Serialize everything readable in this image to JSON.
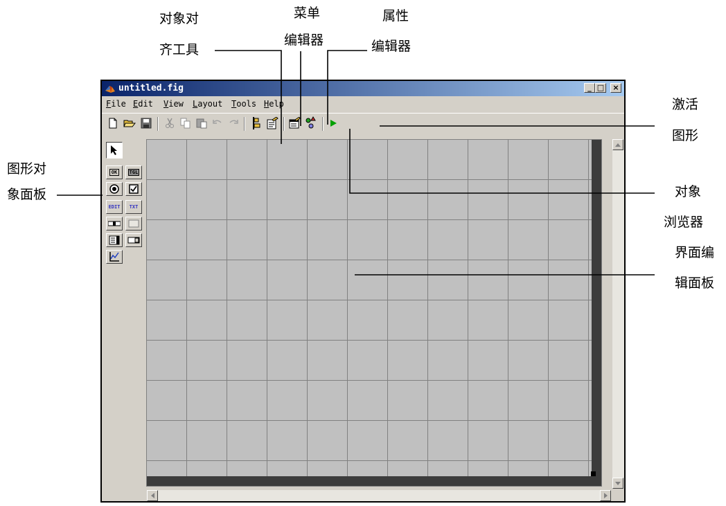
{
  "annotations": {
    "align_line1": "对象对",
    "align_line2": "齐工具",
    "menu_editor_line1": "菜单",
    "menu_editor_line2": "编辑器",
    "property_editor_line1": "属性",
    "property_editor_line2": "编辑器",
    "activate_line1": "激活",
    "activate_line2": "图形",
    "object_palette_line1": "图形对",
    "object_palette_line2": "象面板",
    "object_browser_line1": "对象",
    "object_browser_line2": "浏览器",
    "layout_area_line1": "界面编",
    "layout_area_line2": "辑面板"
  },
  "window": {
    "title": "untitled.fig",
    "controls": {
      "minimize": "_",
      "maximize": "□",
      "close": "×"
    }
  },
  "menu": {
    "items": [
      {
        "mnemonic": "F",
        "rest": "ile"
      },
      {
        "mnemonic": "E",
        "rest": "dit"
      },
      {
        "mnemonic": "V",
        "rest": "iew"
      },
      {
        "mnemonic": "L",
        "rest": "ayout"
      },
      {
        "mnemonic": "T",
        "rest": "ools"
      },
      {
        "mnemonic": "H",
        "rest": "elp"
      }
    ]
  },
  "toolbar": {
    "icons": [
      "new-file-icon",
      "open-folder-icon",
      "save-icon",
      "cut-icon",
      "copy-icon",
      "paste-icon",
      "undo-icon",
      "redo-icon",
      "align-objects-icon",
      "menu-editor-icon",
      "property-editor-icon",
      "object-browser-icon",
      "activate-figure-icon"
    ]
  },
  "palette": {
    "push_button": "OK",
    "toggle_button": "TGL",
    "edit_text": "EDIT",
    "static_text": "TXT"
  },
  "colors": {
    "title_start": "#0a246a",
    "title_end": "#a6caf0",
    "chrome": "#d4d0c8",
    "grid": "#c0c0c0",
    "run_green": "#00a000"
  }
}
